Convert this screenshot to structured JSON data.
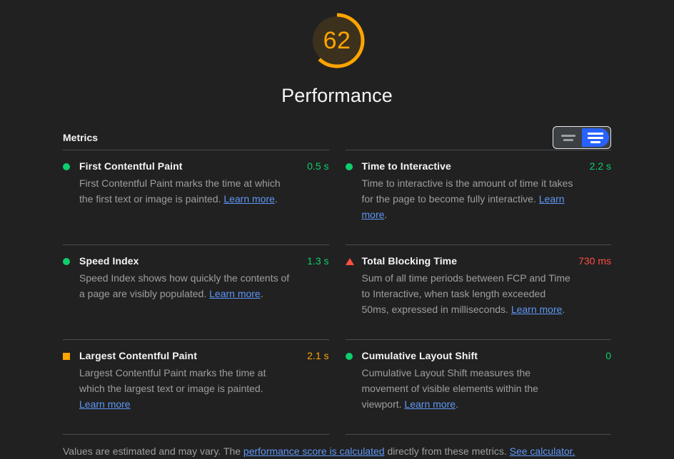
{
  "score": {
    "value": "62",
    "title": "Performance",
    "color": "#ffa400",
    "percent": 62
  },
  "metrics_section": {
    "heading": "Metrics",
    "toggle": {
      "simple_label": "simple-view-toggle",
      "detailed_label": "detailed-view-toggle",
      "selected": "detailed",
      "selected_color": "#2962ff"
    }
  },
  "metrics": [
    {
      "name": "First Contentful Paint",
      "value": "0.5 s",
      "rating": "pass",
      "icon": "circle-icon",
      "color": "#0cce6b",
      "desc_before": "First Contentful Paint marks the time at which the first text or image is painted. ",
      "link": "Learn more",
      "desc_after": "."
    },
    {
      "name": "Time to Interactive",
      "value": "2.2 s",
      "rating": "pass",
      "icon": "circle-icon",
      "color": "#0cce6b",
      "desc_before": "Time to interactive is the amount of time it takes for the page to become fully interactive. ",
      "link": "Learn more",
      "desc_after": "."
    },
    {
      "name": "Speed Index",
      "value": "1.3 s",
      "rating": "pass",
      "icon": "circle-icon",
      "color": "#0cce6b",
      "desc_before": "Speed Index shows how quickly the contents of a page are visibly populated. ",
      "link": "Learn more",
      "desc_after": "."
    },
    {
      "name": "Total Blocking Time",
      "value": "730 ms",
      "rating": "fail",
      "icon": "triangle-icon",
      "color": "#ff4e42",
      "desc_before": "Sum of all time periods between FCP and Time to Interactive, when task length exceeded 50ms, expressed in milliseconds. ",
      "link": "Learn more",
      "desc_after": "."
    },
    {
      "name": "Largest Contentful Paint",
      "value": "2.1 s",
      "rating": "average",
      "icon": "square-icon",
      "color": "#ffa400",
      "desc_before": "Largest Contentful Paint marks the time at which the largest text or image is painted. ",
      "link": "Learn more",
      "desc_after": ""
    },
    {
      "name": "Cumulative Layout Shift",
      "value": "0",
      "rating": "pass",
      "icon": "circle-icon",
      "color": "#0cce6b",
      "desc_before": "Cumulative Layout Shift measures the movement of visible elements within the viewport. ",
      "link": "Learn more",
      "desc_after": "."
    }
  ],
  "footer": {
    "text_before": "Values are estimated and may vary. The ",
    "link1": "performance score is calculated",
    "text_middle": " directly from these metrics. ",
    "link2": "See calculator."
  }
}
